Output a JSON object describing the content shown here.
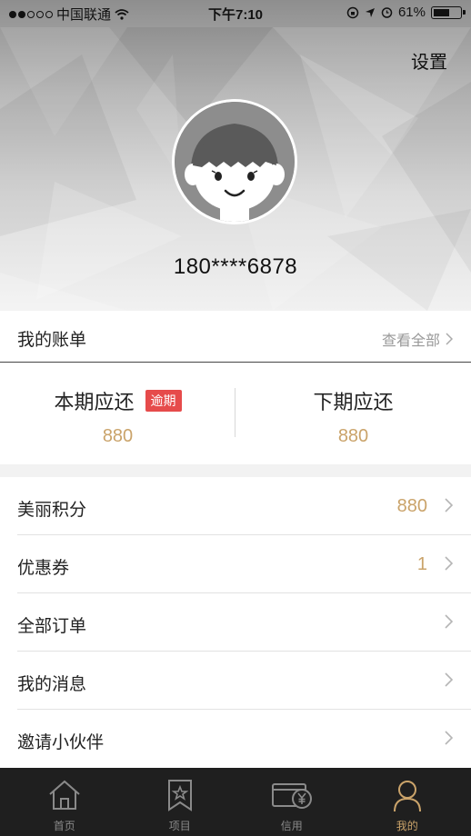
{
  "status_bar": {
    "carrier": "中国联通",
    "time": "下午7:10",
    "battery": "61%"
  },
  "header": {
    "settings_label": "设置",
    "phone": "180****6878"
  },
  "bill": {
    "title": "我的账单",
    "view_all": "查看全部",
    "current": {
      "label": "本期应还",
      "badge": "逾期",
      "value": "880"
    },
    "next": {
      "label": "下期应还",
      "value": "880"
    }
  },
  "menu": [
    {
      "label": "美丽积分",
      "value": "880"
    },
    {
      "label": "优惠券",
      "value": "1"
    },
    {
      "label": "全部订单",
      "value": ""
    },
    {
      "label": "我的消息",
      "value": ""
    },
    {
      "label": "邀请小伙伴",
      "value": ""
    }
  ],
  "tabs": [
    {
      "label": "首页",
      "icon": "home-icon"
    },
    {
      "label": "项目",
      "icon": "bookmark-star-icon"
    },
    {
      "label": "信用",
      "icon": "credit-card-yen-icon"
    },
    {
      "label": "我的",
      "icon": "user-icon",
      "active": true
    }
  ],
  "colors": {
    "accent_gold": "#caa36a",
    "overdue_red": "#e64b4b",
    "tabbar_bg": "#1f1f1f"
  }
}
